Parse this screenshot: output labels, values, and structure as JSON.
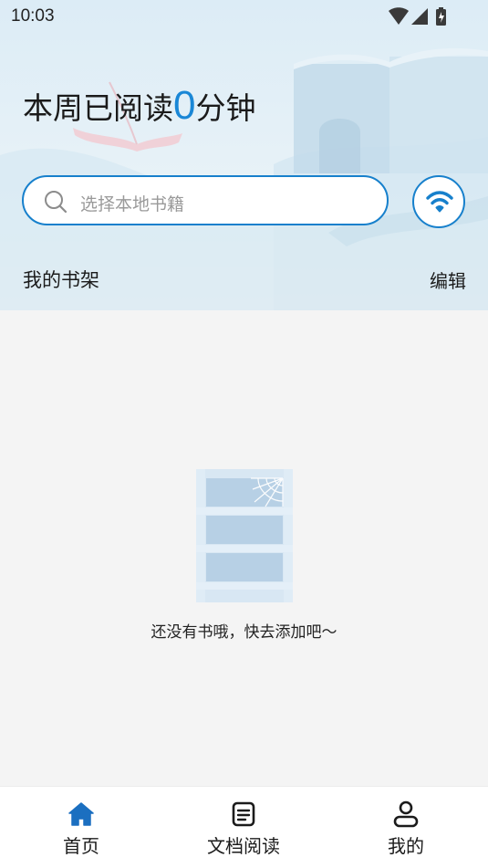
{
  "status_bar": {
    "time": "10:03",
    "icons": [
      "wifi-icon",
      "cellular-signal-icon",
      "battery-charging-icon"
    ]
  },
  "header": {
    "reading_prefix": "本周已阅读",
    "reading_minutes": "0",
    "reading_suffix": "分钟"
  },
  "search": {
    "placeholder": "选择本地书籍",
    "icon": "search-icon"
  },
  "wifi_transfer": {
    "icon": "wifi-icon"
  },
  "bookshelf": {
    "title": "我的书架",
    "edit_label": "编辑",
    "empty_message": "还没有书哦，快去添加吧～",
    "empty_icon": "empty-bookshelf-icon"
  },
  "bottom_nav": {
    "items": [
      {
        "label": "首页",
        "icon": "home-icon",
        "active": true
      },
      {
        "label": "文档阅读",
        "icon": "document-icon",
        "active": false
      },
      {
        "label": "我的",
        "icon": "user-icon",
        "active": false
      }
    ]
  },
  "colors": {
    "accent": "#1780cc",
    "number": "#1a87d6",
    "page_bg": "#f4f4f4"
  }
}
